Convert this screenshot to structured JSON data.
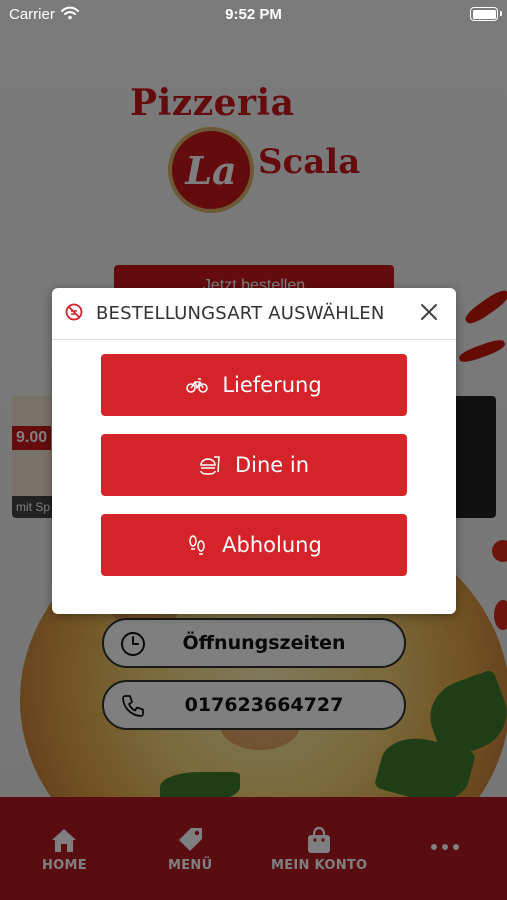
{
  "status_bar": {
    "carrier": "Carrier",
    "time": "9:52 PM"
  },
  "app": {
    "logo_line1": "Pizzeria",
    "logo_mark": "La",
    "logo_line2": "Scala",
    "order_button": "Jetzt bestellen",
    "promo_price": "9.00",
    "promo_caption": "mit Sp",
    "hours_label": "Öffnungszeiten",
    "phone_label": "017623664727",
    "brand_color": "#c8161d"
  },
  "tabbar": {
    "items": [
      {
        "label": "HOME",
        "icon": "home-icon"
      },
      {
        "label": "MENÜ",
        "icon": "tag-icon"
      },
      {
        "label": "MEIN KONTO",
        "icon": "bag-icon"
      },
      {
        "label": "",
        "icon": "more-icon"
      }
    ]
  },
  "modal": {
    "title": "BESTELLUNGSART AUSWÄHLEN",
    "header_icon": "food-slash-icon",
    "close_icon": "close-icon",
    "options": [
      {
        "label": "Lieferung",
        "icon": "bicycle-icon"
      },
      {
        "label": "Dine in",
        "icon": "burger-drink-icon"
      },
      {
        "label": "Abholung",
        "icon": "footprints-icon"
      }
    ],
    "button_color": "#d4242a"
  }
}
